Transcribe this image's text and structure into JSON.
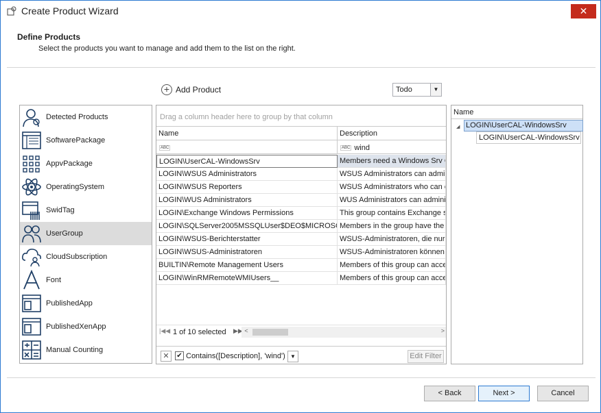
{
  "window": {
    "title": "Create Product Wizard",
    "close_glyph": "✕"
  },
  "header": {
    "title": "Define Products",
    "subtitle": "Select the products you want to manage and add them to the list on the right."
  },
  "toolbar": {
    "add_product_label": "Add Product",
    "filter_combo_value": "Todo"
  },
  "product_types": [
    {
      "label": "Detected Products",
      "icon": "user-search-icon"
    },
    {
      "label": "SoftwarePackage",
      "icon": "software-package-icon"
    },
    {
      "label": "AppvPackage",
      "icon": "appv-package-icon"
    },
    {
      "label": "OperatingSystem",
      "icon": "atom-icon"
    },
    {
      "label": "SwidTag",
      "icon": "barcode-icon"
    },
    {
      "label": "UserGroup",
      "icon": "user-group-icon",
      "selected": true
    },
    {
      "label": "CloudSubscription",
      "icon": "cloud-user-icon"
    },
    {
      "label": "Font",
      "icon": "font-icon"
    },
    {
      "label": "PublishedApp",
      "icon": "published-app-icon"
    },
    {
      "label": "PublishedXenApp",
      "icon": "published-xenapp-icon"
    },
    {
      "label": "Manual Counting",
      "icon": "calculator-icon"
    }
  ],
  "grid": {
    "group_hint": "Drag a column header here to group by that column",
    "columns": {
      "name": "Name",
      "description": "Description"
    },
    "filters": {
      "name": "",
      "description": "wind"
    },
    "rows": [
      {
        "name": "LOGIN\\UserCAL-WindowsSrv",
        "description": "Members need a Windows Srv C"
      },
      {
        "name": "LOGIN\\WSUS Administrators",
        "description": "WSUS Administrators can admini"
      },
      {
        "name": "LOGIN\\WSUS Reporters",
        "description": "WSUS Administrators who can o"
      },
      {
        "name": "LOGIN\\WUS Administrators",
        "description": "WUS Administrators can adminis"
      },
      {
        "name": "LOGIN\\Exchange Windows Permissions",
        "description": "This group contains Exchange se"
      },
      {
        "name": "LOGIN\\SQLServer2005MSSQLUser$DEO$MICROSO...",
        "description": "Members in the group have the r"
      },
      {
        "name": "LOGIN\\WSUS-Berichterstatter",
        "description": "WSUS-Administratoren, die nur E"
      },
      {
        "name": "LOGIN\\WSUS-Administratoren",
        "description": "WSUS-Administratoren können c"
      },
      {
        "name": "BUILTIN\\Remote Management Users",
        "description": "Members of this group can acces"
      },
      {
        "name": "LOGIN\\WinRMRemoteWMIUsers__",
        "description": "Members of this group can acces"
      }
    ],
    "pager_text": "1 of 10 selected",
    "filter_expression": "Contains([Description], 'wind')",
    "filter_checked": true,
    "edit_filter_label": "Edit Filter"
  },
  "selected_panel": {
    "column": "Name",
    "node": "LOGIN\\UserCAL-WindowsSrv",
    "child": "LOGIN\\UserCAL-WindowsSrv"
  },
  "buttons": {
    "back": "< Back",
    "next": "Next >",
    "cancel": "Cancel"
  },
  "colors": {
    "accent": "#2b79d1",
    "selected_row": "#dcdcdc",
    "close": "#c42b1c"
  }
}
